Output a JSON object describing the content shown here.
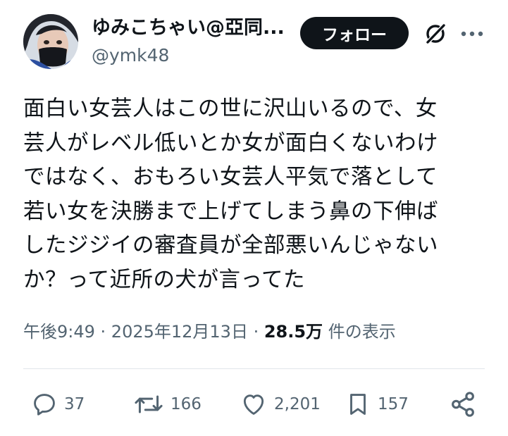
{
  "author": {
    "display_name": "ゆみこちゃい@亞同...",
    "handle": "@ymk48"
  },
  "header": {
    "follow_label": "フォロー",
    "grok_icon": "grok-icon",
    "more_icon": "more-dots-icon"
  },
  "tweet": {
    "text": "面白い女芸人はこの世に沢山いるので、女\n芸人がレベル低いとか女が面白くないわけ\nではなく、おもろい女芸人平気で落として\n若い女を決勝まで上げてしまう鼻の下伸ば\nしたジジイの審査員が全部悪いんじゃない\nか？って近所の犬が言ってた"
  },
  "meta": {
    "time": "午後9:49",
    "sep1": " · ",
    "date": "2025年12月13日",
    "sep2": " · ",
    "views": "28.5万",
    "views_label": " 件の表示"
  },
  "actions": {
    "replies": "37",
    "reposts": "166",
    "likes": "2,201",
    "bookmarks": "157"
  },
  "colors": {
    "text": "#0f1419",
    "secondary": "#536471",
    "button_bg": "#0f1419",
    "divider": "#e1e6ea"
  }
}
